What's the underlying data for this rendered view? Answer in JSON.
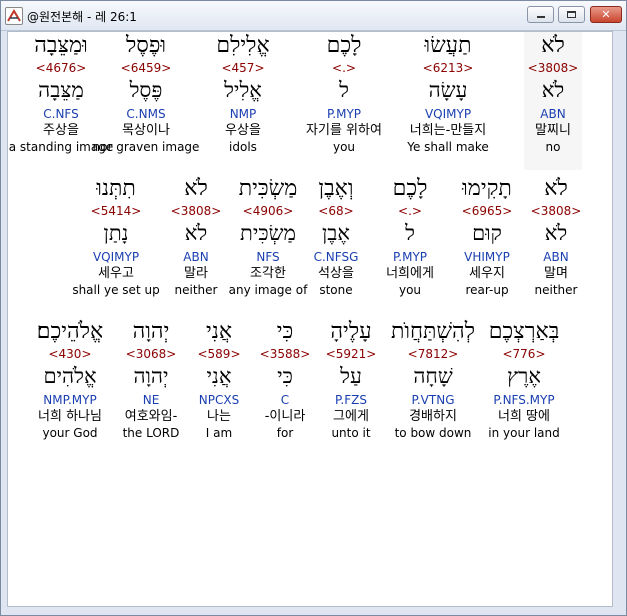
{
  "window": {
    "title": "@원전본해 - 레 26:1",
    "min_label": "",
    "max_label": "",
    "close_label": "✕"
  },
  "rows": [
    [
      {
        "heb": "וּמַצֵּבָה",
        "num": "<4676>",
        "lemma": "מַצֵּבָה",
        "parse": "C.NFS",
        "kor": "주상을",
        "eng": "a standing image"
      },
      {
        "heb": "וּפֶסֶל",
        "num": "<6459>",
        "lemma": "פֶּסֶל",
        "parse": "C.NMS",
        "kor": "목상이나",
        "eng": "nor graven image"
      },
      {
        "heb": "אֱלִילִם",
        "num": "<457>",
        "lemma": "אֱלִיל",
        "parse": "NMP",
        "kor": "우상을",
        "eng": "idols"
      },
      {
        "heb": "לָכֶם",
        "num": "<.>",
        "lemma": "ל",
        "parse": "P.MYP",
        "kor": "자기를 위하여",
        "eng": "you"
      },
      {
        "heb": "תַעֲשׂוּ",
        "num": "<6213>",
        "lemma": "עָשָׂה",
        "parse": "VQIMYP",
        "kor": "너희는-만들지",
        "eng": "Ye shall make"
      },
      {
        "heb": "לֹא",
        "num": "<3808>",
        "lemma": "לֹא",
        "parse": "ABN",
        "kor": "말찌니",
        "eng": "no"
      }
    ],
    [
      {
        "heb": "תִתְּנוּ",
        "num": "<5414>",
        "lemma": "נָתַן",
        "parse": "VQIMYP",
        "kor": "세우고",
        "eng": "shall ye set up"
      },
      {
        "heb": "לֹא",
        "num": "<3808>",
        "lemma": "לֹא",
        "parse": "ABN",
        "kor": "말라",
        "eng": "neither"
      },
      {
        "heb": "מַשְׂכִּית",
        "num": "<4906>",
        "lemma": "מַשְׂכִּית",
        "parse": "NFS",
        "kor": "조각한",
        "eng": "any image of"
      },
      {
        "heb": "וְאֶבֶן",
        "num": "<68>",
        "lemma": "אֶבֶן",
        "parse": "C.NFSG",
        "kor": "석상을",
        "eng": "stone"
      },
      {
        "heb": "לָכֶם",
        "num": "<.>",
        "lemma": "ל",
        "parse": "P.MYP",
        "kor": "너희에게",
        "eng": "you"
      },
      {
        "heb": "תָקִימוּ",
        "num": "<6965>",
        "lemma": "קוּם",
        "parse": "VHIMYP",
        "kor": "세우지",
        "eng": "rear-up"
      },
      {
        "heb": "לֹא",
        "num": "<3808>",
        "lemma": "לֹא",
        "parse": "ABN",
        "kor": "말며",
        "eng": "neither"
      }
    ],
    [
      {
        "heb": "אֱלֹהֵיכֶם׃",
        "num": "<430>",
        "lemma": "אֱלֹהִים",
        "parse": "NMP.MYP",
        "kor": "너희 하나님",
        "eng": "your God"
      },
      {
        "heb": "יְהוָה",
        "num": "<3068>",
        "lemma": "יְהוָה",
        "parse": "NE",
        "kor": "여호와임-",
        "eng": "the LORD"
      },
      {
        "heb": "אֲנִי",
        "num": "<589>",
        "lemma": "אֲנִי",
        "parse": "NPCXS",
        "kor": "나는",
        "eng": "I am"
      },
      {
        "heb": "כִּי",
        "num": "<3588>",
        "lemma": "כִּי",
        "parse": "C",
        "kor": "-이니라",
        "eng": "for"
      },
      {
        "heb": "עָלֶיהָ",
        "num": "<5921>",
        "lemma": "עַל",
        "parse": "P.FZS",
        "kor": "그에게",
        "eng": "unto it"
      },
      {
        "heb": "לְהִשְׁתַּחֲוֺת",
        "num": "<7812>",
        "lemma": "שָׁחָה",
        "parse": "P.VTNG",
        "kor": "경배하지",
        "eng": "to bow down"
      },
      {
        "heb": "בְּאַרְצְכֶם",
        "num": "<776>",
        "lemma": "אֶרֶץ",
        "parse": "P.NFS.MYP",
        "kor": "너희 땅에",
        "eng": "in your land"
      }
    ]
  ]
}
